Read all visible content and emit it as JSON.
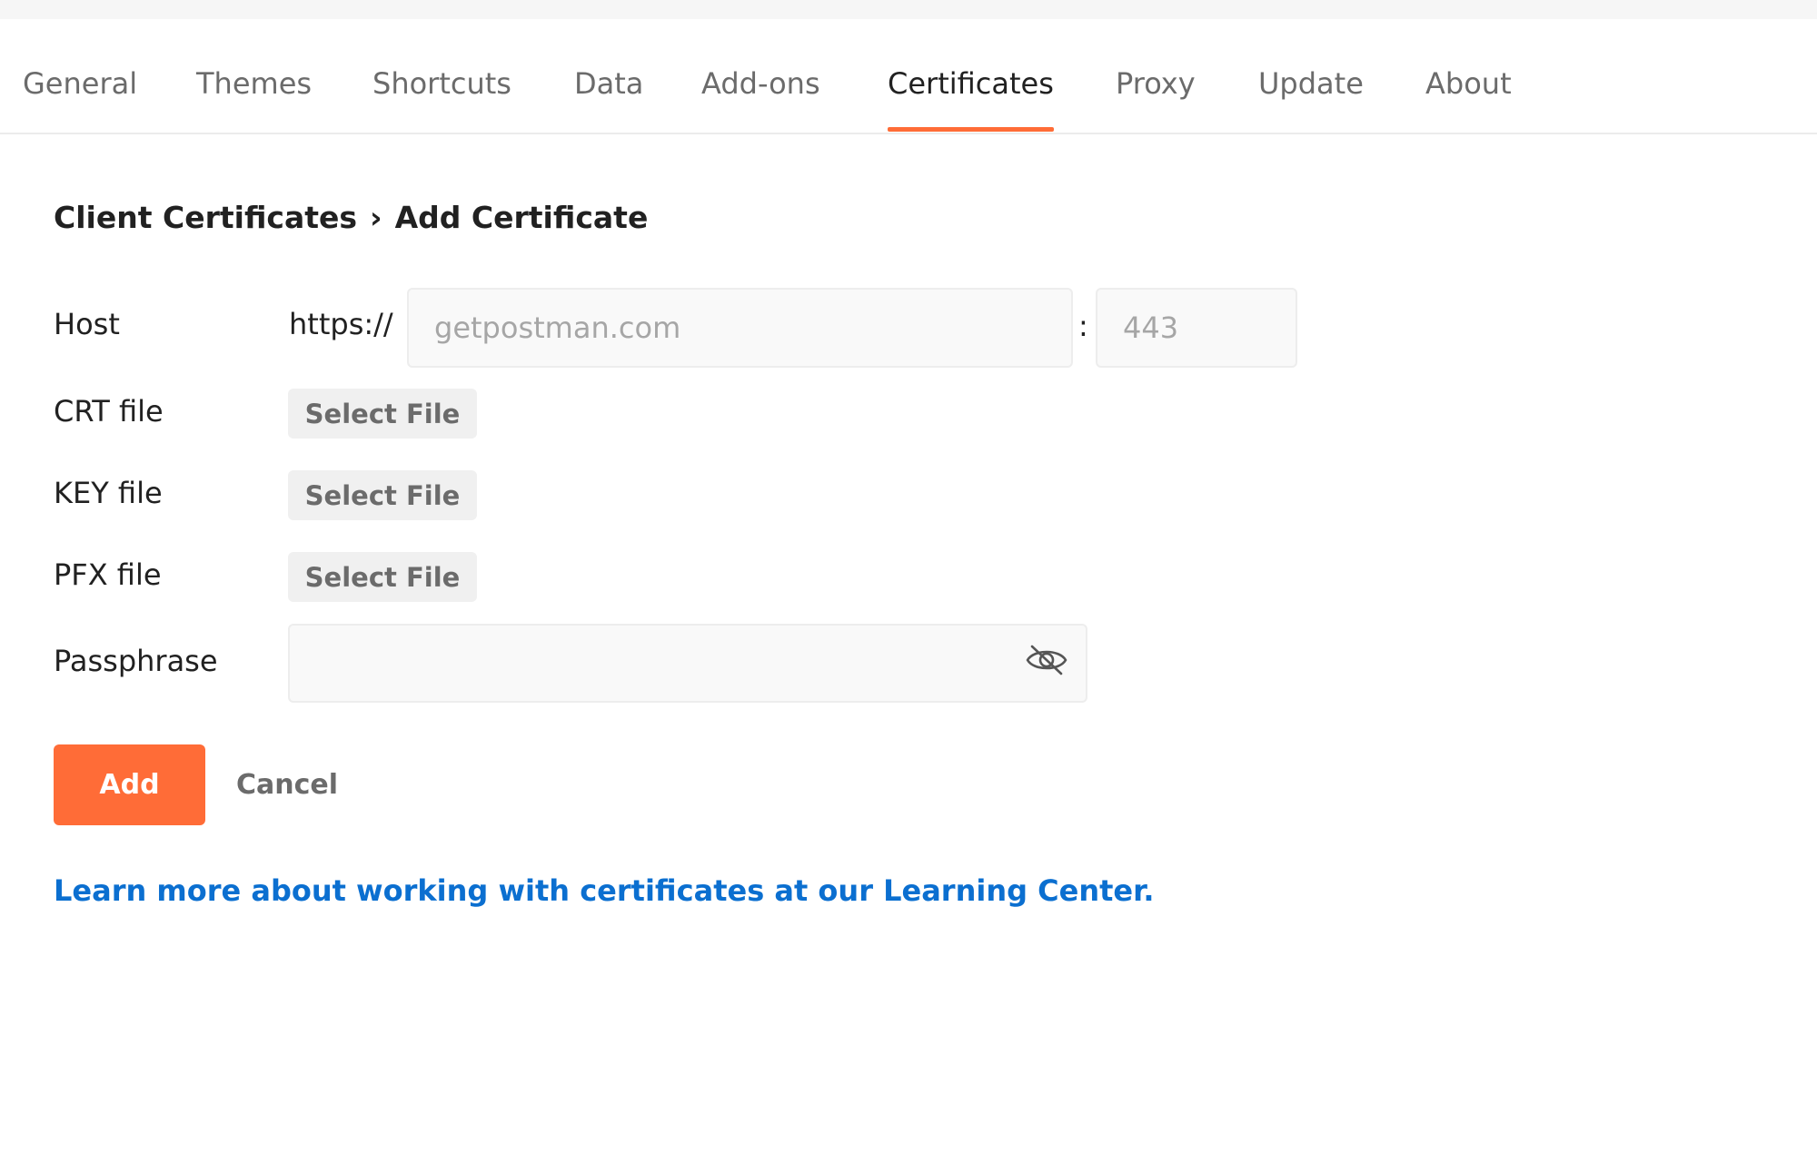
{
  "tabs": [
    {
      "label": "General",
      "active": false
    },
    {
      "label": "Themes",
      "active": false
    },
    {
      "label": "Shortcuts",
      "active": false
    },
    {
      "label": "Data",
      "active": false
    },
    {
      "label": "Add-ons",
      "active": false
    },
    {
      "label": "Certificates",
      "active": true
    },
    {
      "label": "Proxy",
      "active": false
    },
    {
      "label": "Update",
      "active": false
    },
    {
      "label": "About",
      "active": false
    }
  ],
  "breadcrumb": {
    "parent": "Client Certificates",
    "separator": "›",
    "current": "Add Certificate"
  },
  "form": {
    "host_label": "Host",
    "host_prefix": "https://",
    "host_placeholder": "getpostman.com",
    "host_value": "",
    "colon": ":",
    "port_placeholder": "443",
    "port_value": "",
    "crt_label": "CRT file",
    "key_label": "KEY file",
    "pfx_label": "PFX file",
    "select_file_label": "Select File",
    "passphrase_label": "Passphrase",
    "passphrase_value": "",
    "passphrase_toggle_icon": "eye-slash-icon"
  },
  "actions": {
    "add_label": "Add",
    "cancel_label": "Cancel"
  },
  "learn_link": "Learn more about working with certificates at our Learning Center.",
  "colors": {
    "accent": "#ff6c37",
    "link": "#0b6fd0"
  }
}
